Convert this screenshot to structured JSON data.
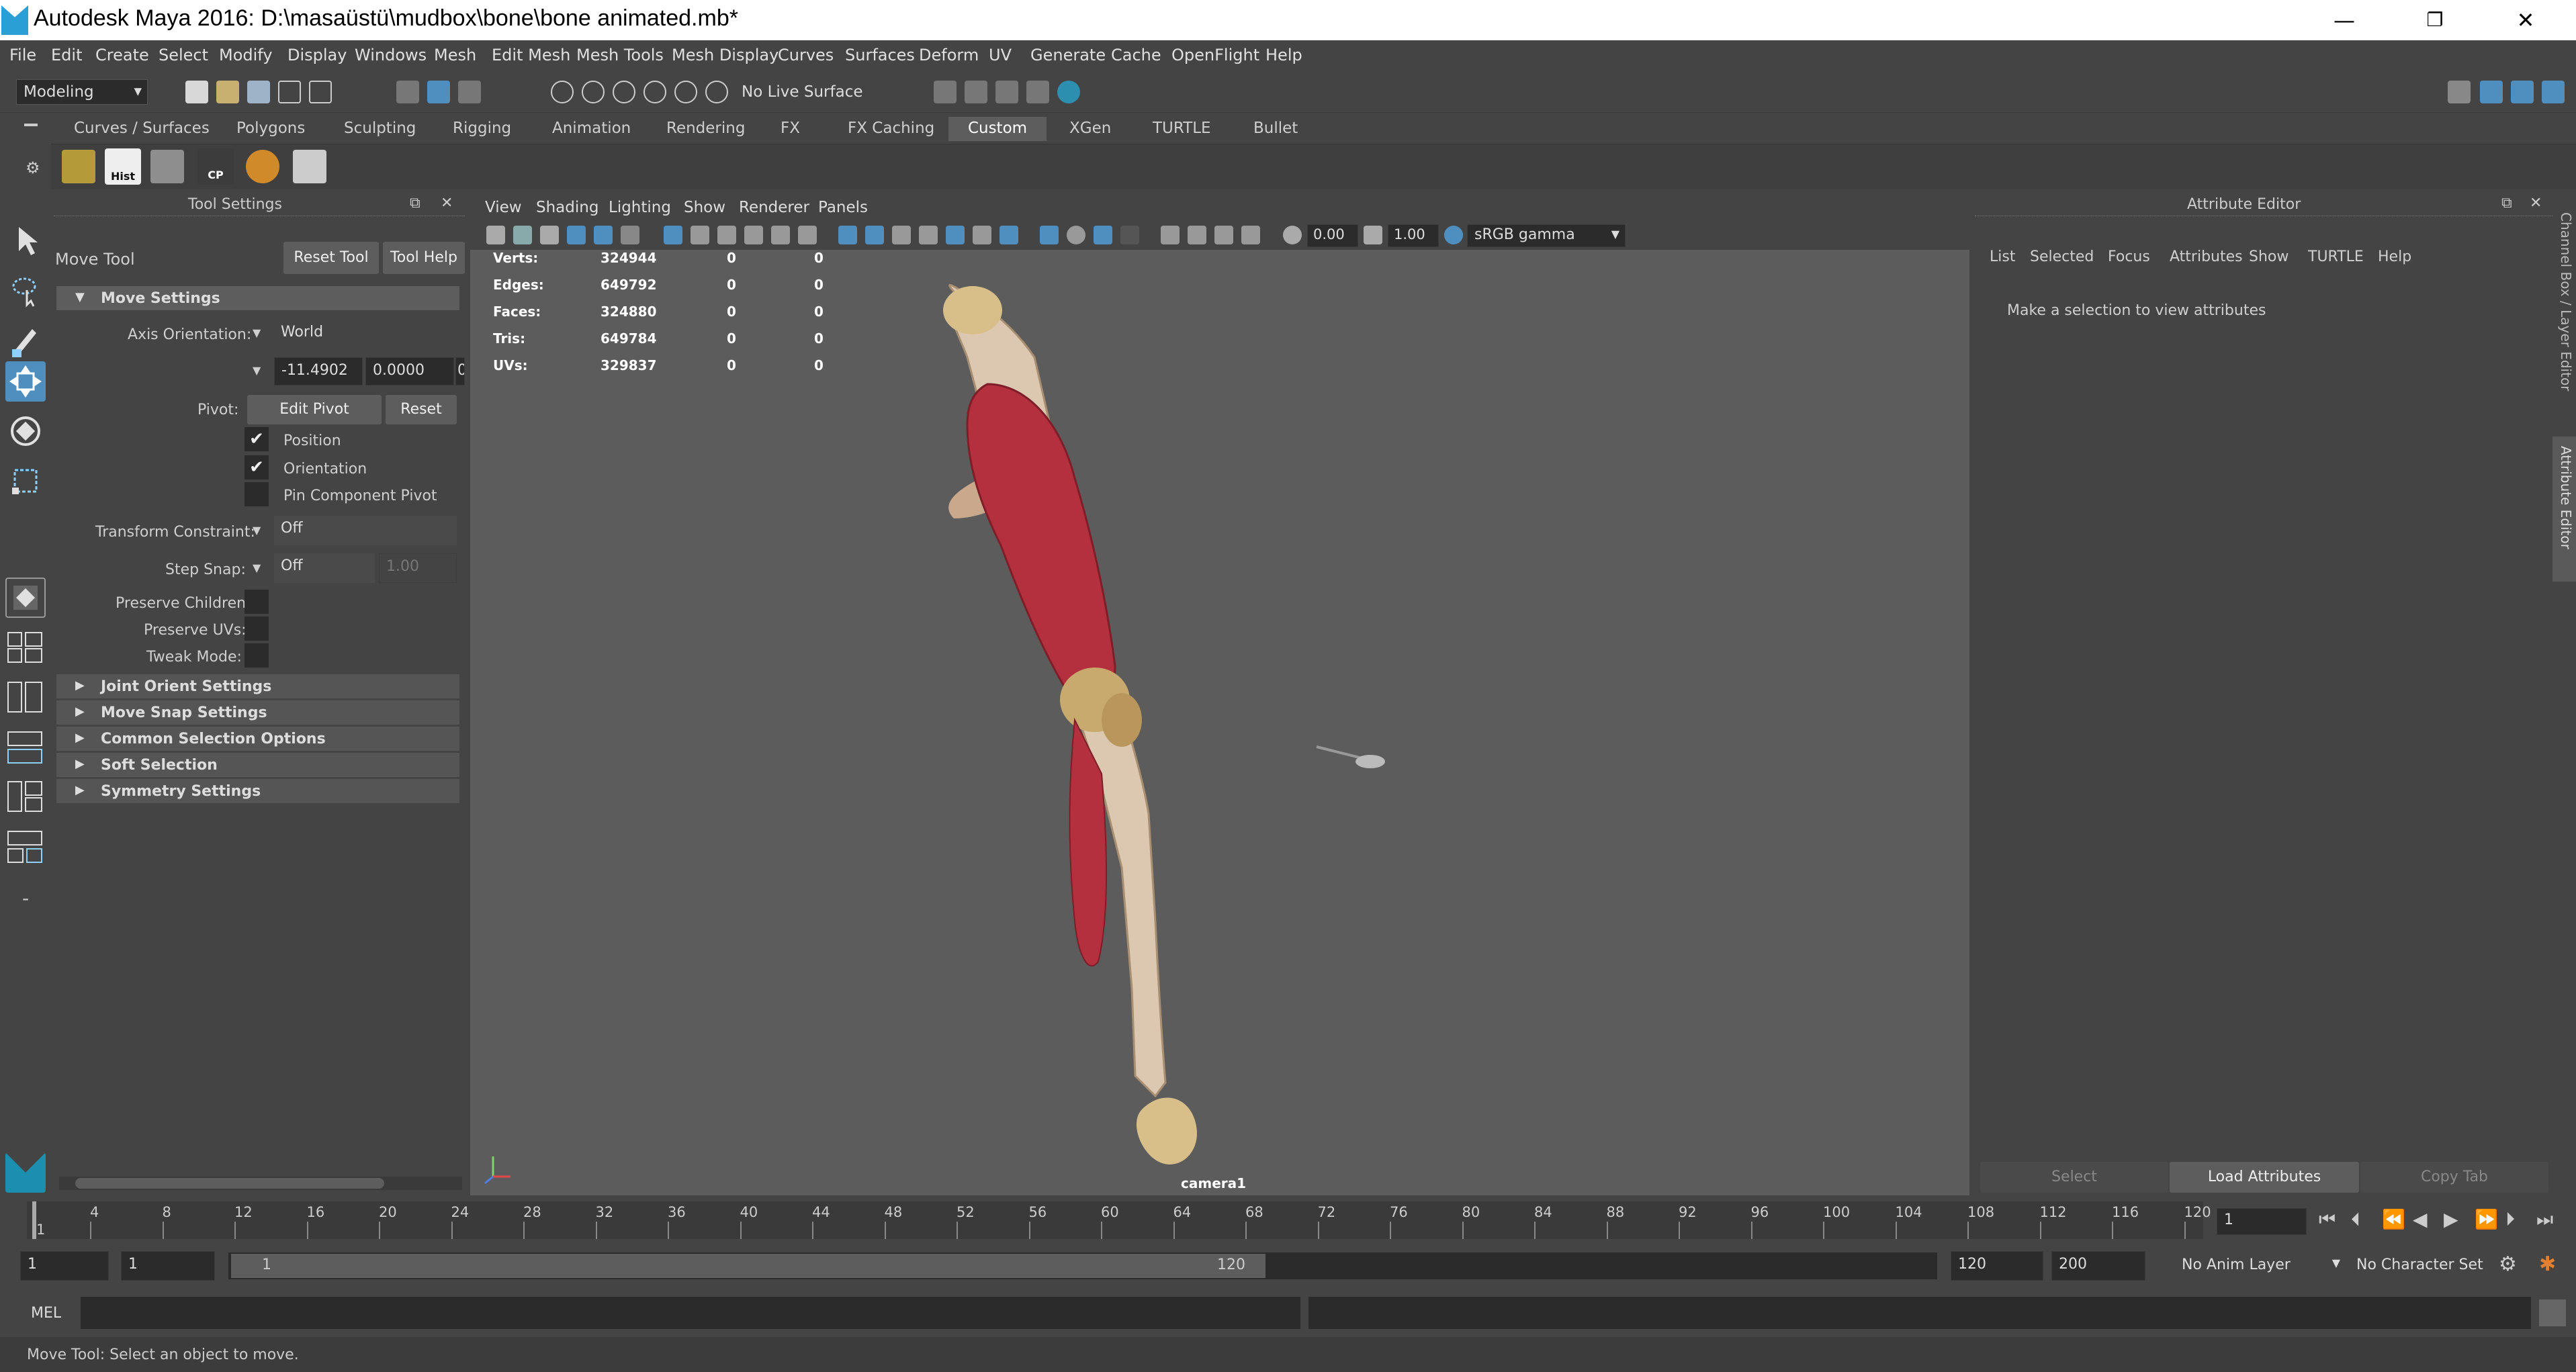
{
  "window": {
    "title": "Autodesk Maya 2016: D:\\masaüstü\\mudbox\\bone\\bone animated.mb*",
    "minimize": "—",
    "restore": "❐",
    "close": "✕"
  },
  "menus": [
    "File",
    "Edit",
    "Create",
    "Select",
    "Modify",
    "Display",
    "Windows",
    "Mesh",
    "Edit Mesh",
    "Mesh Tools",
    "Mesh Display",
    "Curves",
    "Surfaces",
    "Deform",
    "UV",
    "Generate",
    "Cache",
    "OpenFlight",
    "Help"
  ],
  "statusline": {
    "mode": "Modeling",
    "live_surface": "No Live Surface"
  },
  "shelf_tabs": [
    "Curves / Surfaces",
    "Polygons",
    "Sculpting",
    "Rigging",
    "Animation",
    "Rendering",
    "FX",
    "FX Caching",
    "Custom",
    "XGen",
    "TURTLE",
    "Bullet"
  ],
  "shelf_active": "Custom",
  "shelf_icons": {
    "hist": "Hist",
    "cp": "CP"
  },
  "tool_settings": {
    "panel_title": "Tool Settings",
    "tool_name": "Move Tool",
    "reset_tool": "Reset Tool",
    "tool_help": "Tool Help",
    "move_settings": "Move Settings",
    "axis_orientation_label": "Axis Orientation:",
    "axis_orientation_value": "World",
    "coord_x": "-11.4902",
    "coord_y": "0.0000",
    "coord_z": "0",
    "pivot_label": "Pivot:",
    "edit_pivot": "Edit Pivot",
    "reset": "Reset",
    "position": "Position",
    "orientation": "Orientation",
    "pin_component_pivot": "Pin Component Pivot",
    "transform_constraint_label": "Transform Constraint:",
    "transform_constraint_value": "Off",
    "step_snap_label": "Step Snap:",
    "step_snap_value": "Off",
    "step_snap_amount": "1.00",
    "preserve_children": "Preserve Children:",
    "preserve_uvs": "Preserve UVs:",
    "tweak_mode": "Tweak Mode:",
    "sections": [
      "Joint Orient Settings",
      "Move Snap Settings",
      "Common Selection Options",
      "Soft Selection",
      "Symmetry Settings"
    ]
  },
  "viewport": {
    "menu": [
      "View",
      "Shading",
      "Lighting",
      "Show",
      "Renderer",
      "Panels"
    ],
    "exposure": "0.00",
    "gamma": "1.00",
    "color_space": "sRGB gamma",
    "camera": "camera1",
    "hud": [
      {
        "label": "Verts:",
        "v1": "324944",
        "v2": "0",
        "v3": "0"
      },
      {
        "label": "Edges:",
        "v1": "649792",
        "v2": "0",
        "v3": "0"
      },
      {
        "label": "Faces:",
        "v1": "324880",
        "v2": "0",
        "v3": "0"
      },
      {
        "label": "Tris:",
        "v1": "649784",
        "v2": "0",
        "v3": "0"
      },
      {
        "label": "UVs:",
        "v1": "329837",
        "v2": "0",
        "v3": "0"
      }
    ]
  },
  "attribute_editor": {
    "title": "Attribute Editor",
    "menu": [
      "List",
      "Selected",
      "Focus",
      "Attributes",
      "Show",
      "TURTLE",
      "Help"
    ],
    "message": "Make a selection to view attributes",
    "select": "Select",
    "load_attributes": "Load Attributes",
    "copy_tab": "Copy Tab",
    "side_tab_channel": "Channel Box / Layer Editor",
    "side_tab_attr": "Attribute Editor"
  },
  "timeline": {
    "ticks": [
      "4",
      "8",
      "12",
      "16",
      "20",
      "24",
      "28",
      "32",
      "36",
      "40",
      "44",
      "48",
      "52",
      "56",
      "60",
      "64",
      "68",
      "72",
      "76",
      "80",
      "84",
      "88",
      "92",
      "96",
      "100",
      "104",
      "108",
      "112",
      "116",
      "120"
    ],
    "current_frame_label": "1",
    "current_frame": "1"
  },
  "range": {
    "start": "1",
    "start2": "1",
    "slider_start": "1",
    "slider_end": "120",
    "end": "120",
    "end2": "200",
    "anim_layer": "No Anim Layer",
    "char_set": "No Character Set"
  },
  "command": {
    "mel": "MEL"
  },
  "help_line": "Move Tool: Select an object to move."
}
